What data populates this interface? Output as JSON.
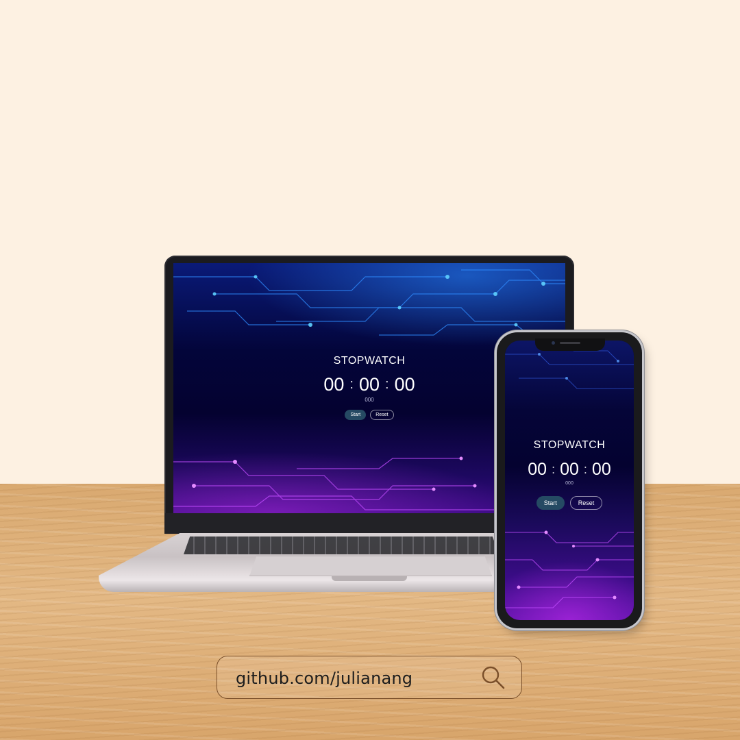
{
  "scene": {
    "background_color": "#fdf1e2",
    "desk_color": "#dfb17c"
  },
  "laptop_app": {
    "title": "STOPWATCH",
    "hours": "00",
    "minutes": "00",
    "seconds": "00",
    "separator": ":",
    "milliseconds": "000",
    "start_label": "Start",
    "reset_label": "Reset"
  },
  "phone_app": {
    "title": "STOPWATCH",
    "hours": "00",
    "minutes": "00",
    "seconds": "00",
    "separator": ":",
    "milliseconds": "000",
    "start_label": "Start",
    "reset_label": "Reset"
  },
  "colors": {
    "start_button": "#254a63",
    "screen_top": "#0a1a78",
    "screen_bottom": "#3a0b85"
  },
  "url_bar": {
    "text": "github.com/julianang",
    "icon": "search-icon"
  }
}
